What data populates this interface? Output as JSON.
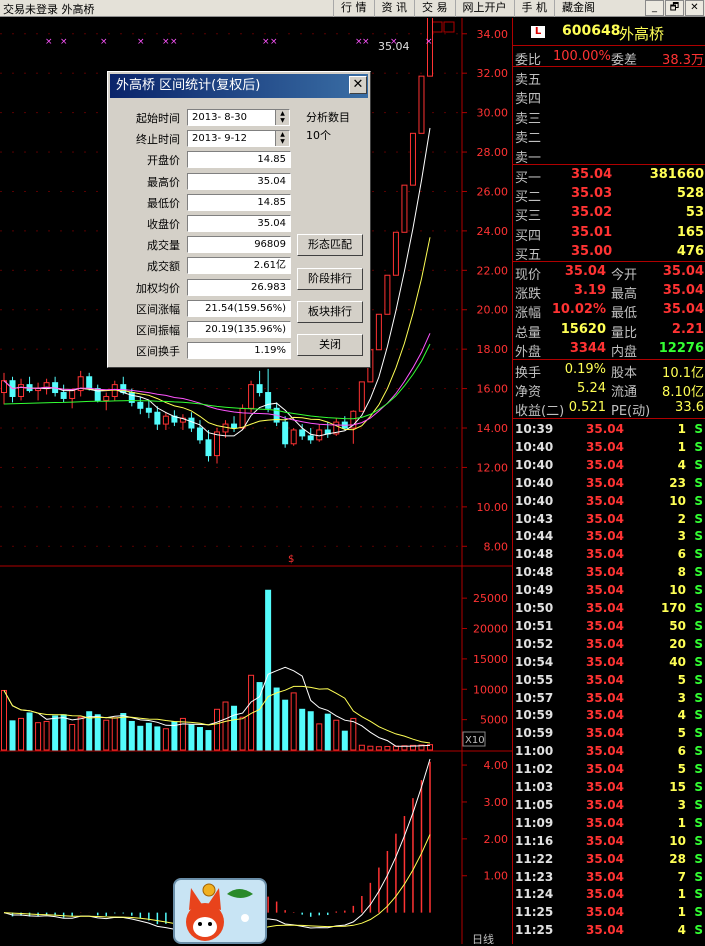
{
  "window": {
    "title": "交易未登录   外高桥",
    "menus": [
      "行 情",
      "资 讯",
      "交 易",
      "网上开户",
      "手 机",
      "藏金阁"
    ],
    "controls": [
      "_",
      "🗗",
      "✕"
    ]
  },
  "stock": {
    "code": "600648",
    "name": "外高桥",
    "badge": "L"
  },
  "chart_data": [
    {
      "type": "candlestick",
      "panel": "price",
      "ylim": [
        7,
        34.8
      ],
      "y_ticks": [
        "34.00",
        "32.00",
        "30.00",
        "28.00",
        "26.00",
        "24.00",
        "22.00",
        "20.00",
        "18.00",
        "16.00",
        "14.00",
        "12.00",
        "10.00",
        "8.00"
      ],
      "last_price_label": "35.04",
      "candles": [
        [
          15.8,
          16.8,
          15.2,
          16.4
        ],
        [
          16.4,
          16.6,
          15.3,
          15.6
        ],
        [
          15.6,
          16.5,
          15.4,
          16.2
        ],
        [
          16.2,
          16.6,
          15.8,
          15.9
        ],
        [
          15.9,
          16.3,
          15.4,
          16.0
        ],
        [
          16.0,
          16.5,
          15.7,
          16.3
        ],
        [
          16.3,
          16.6,
          15.6,
          15.8
        ],
        [
          15.8,
          16.2,
          15.3,
          15.5
        ],
        [
          15.5,
          16.0,
          15.0,
          15.9
        ],
        [
          15.9,
          16.9,
          15.6,
          16.6
        ],
        [
          16.6,
          16.8,
          15.9,
          16.0
        ],
        [
          16.0,
          16.2,
          15.3,
          15.4
        ],
        [
          15.4,
          15.8,
          14.9,
          15.6
        ],
        [
          15.6,
          16.4,
          15.4,
          16.2
        ],
        [
          16.2,
          16.6,
          15.7,
          15.8
        ],
        [
          15.8,
          16.0,
          15.1,
          15.3
        ],
        [
          15.3,
          15.6,
          14.7,
          15.0
        ],
        [
          15.0,
          15.4,
          14.5,
          14.8
        ],
        [
          14.8,
          15.1,
          13.9,
          14.2
        ],
        [
          14.2,
          14.8,
          13.9,
          14.6
        ],
        [
          14.6,
          14.9,
          14.1,
          14.3
        ],
        [
          14.3,
          14.7,
          13.9,
          14.5
        ],
        [
          14.5,
          14.8,
          13.8,
          14.0
        ],
        [
          14.0,
          14.4,
          13.2,
          13.4
        ],
        [
          13.4,
          13.9,
          12.3,
          12.6
        ],
        [
          12.6,
          14.0,
          12.2,
          13.8
        ],
        [
          13.8,
          14.4,
          13.5,
          14.2
        ],
        [
          14.2,
          14.6,
          13.8,
          14.0
        ],
        [
          14.0,
          15.2,
          13.9,
          15.0
        ],
        [
          15.0,
          16.4,
          14.8,
          16.2
        ],
        [
          16.2,
          16.9,
          15.6,
          15.8
        ],
        [
          15.8,
          17.0,
          14.8,
          15.0
        ],
        [
          15.0,
          15.3,
          14.1,
          14.3
        ],
        [
          14.3,
          14.6,
          13.0,
          13.2
        ],
        [
          13.2,
          14.0,
          13.1,
          13.9
        ],
        [
          13.9,
          14.2,
          13.4,
          13.6
        ],
        [
          13.6,
          14.0,
          13.2,
          13.4
        ],
        [
          13.4,
          14.2,
          13.3,
          13.9
        ],
        [
          13.9,
          14.3,
          13.5,
          13.7
        ],
        [
          13.7,
          14.5,
          13.6,
          14.3
        ],
        [
          14.3,
          14.6,
          13.9,
          14.0
        ],
        [
          14.0,
          14.9,
          13.2,
          14.85
        ],
        [
          14.85,
          16.34,
          14.85,
          16.34
        ],
        [
          16.34,
          17.97,
          16.34,
          17.97
        ],
        [
          17.97,
          19.77,
          17.97,
          19.77
        ],
        [
          19.77,
          21.75,
          19.77,
          21.75
        ],
        [
          21.75,
          23.93,
          21.75,
          23.93
        ],
        [
          23.93,
          26.32,
          23.93,
          26.32
        ],
        [
          26.32,
          28.95,
          26.32,
          28.95
        ],
        [
          28.95,
          31.85,
          28.95,
          31.85
        ],
        [
          31.85,
          35.04,
          31.85,
          35.04
        ]
      ],
      "volume": [
        9800,
        4800,
        5200,
        6100,
        4500,
        4700,
        5600,
        5800,
        4200,
        5400,
        6300,
        5800,
        4900,
        5300,
        6000,
        4700,
        3900,
        4400,
        3800,
        3500,
        4600,
        5200,
        4100,
        3700,
        3200,
        6700,
        7900,
        7200,
        5400,
        12300,
        11100,
        26300,
        10200,
        8200,
        9400,
        6700,
        6300,
        4300,
        5900,
        4900,
        3100,
        5200,
        780,
        620,
        540,
        580,
        620,
        700,
        760,
        820,
        880
      ],
      "vol_ylim": [
        0,
        27000
      ],
      "vol_ticks": [
        "25000",
        "20000",
        "15000",
        "10000",
        "5000"
      ],
      "vol_unit": "X10",
      "macd_ylim": [
        -0.85,
        4.3
      ],
      "macd_ticks": [
        "4.00",
        "3.00",
        "2.00",
        "1.00"
      ]
    }
  ],
  "dialog": {
    "title": "外高桥  区间统计(复权后)",
    "close": "✕",
    "fields": [
      {
        "label": "起始时间",
        "value": "2013- 8-30"
      },
      {
        "label": "终止时间",
        "value": "2013- 9-12"
      },
      {
        "label": "开盘价",
        "value": "14.85"
      },
      {
        "label": "最高价",
        "value": "35.04"
      },
      {
        "label": "最低价",
        "value": "14.85"
      },
      {
        "label": "收盘价",
        "value": "35.04"
      },
      {
        "label": "成交量",
        "value": "96809"
      },
      {
        "label": "成交额",
        "value": "2.61亿"
      },
      {
        "label": "加权均价",
        "value": "26.983"
      },
      {
        "label": "区间涨幅",
        "value": "21.54(159.56%)"
      },
      {
        "label": "区间振幅",
        "value": "20.19(135.96%)"
      },
      {
        "label": "区间换手",
        "value": "1.19%"
      }
    ],
    "analysis_label": "分析数目",
    "analysis_value": "10个",
    "buttons": [
      "形态匹配",
      "阶段排行",
      "板块排行",
      "关闭"
    ]
  },
  "quote": {
    "webi_label": "委比",
    "webi": "100.00%",
    "weicha_label": "委差",
    "weicha": "38.3万",
    "sells": [
      "卖五",
      "卖四",
      "卖三",
      "卖二",
      "卖一"
    ],
    "buys": [
      {
        "l": "买一",
        "p": "35.04",
        "v": "381660"
      },
      {
        "l": "买二",
        "p": "35.03",
        "v": "528"
      },
      {
        "l": "买三",
        "p": "35.02",
        "v": "53"
      },
      {
        "l": "买四",
        "p": "35.01",
        "v": "165"
      },
      {
        "l": "买五",
        "p": "35.00",
        "v": "476"
      }
    ],
    "stats1": [
      {
        "l1": "现价",
        "v1": "35.04",
        "c1": "#ff3333",
        "l2": "今开",
        "v2": "35.04",
        "c2": "#ff3333"
      },
      {
        "l1": "涨跌",
        "v1": "3.19",
        "c1": "#ff3333",
        "l2": "最高",
        "v2": "35.04",
        "c2": "#ff3333"
      },
      {
        "l1": "涨幅",
        "v1": "10.02%",
        "c1": "#ff3333",
        "l2": "最低",
        "v2": "35.04",
        "c2": "#ff3333"
      },
      {
        "l1": "总量",
        "v1": "15620",
        "c1": "#ffff55",
        "l2": "量比",
        "v2": "2.21",
        "c2": "#ff3333"
      },
      {
        "l1": "外盘",
        "v1": "3344",
        "c1": "#ff3333",
        "l2": "内盘",
        "v2": "12276",
        "c2": "#33ff33"
      }
    ],
    "stats2": [
      {
        "l1": "换手",
        "v1": "0.19%",
        "l2": "股本",
        "v2": "10.1亿"
      },
      {
        "l1": "净资",
        "v1": "5.24",
        "l2": "流通",
        "v2": "8.10亿"
      },
      {
        "l1": "收益(二)",
        "v1": "0.521",
        "l2": "PE(动)",
        "v2": "33.6"
      }
    ],
    "ticks": [
      [
        "10:39",
        "35.04",
        "1",
        "S"
      ],
      [
        "10:40",
        "35.04",
        "1",
        "S"
      ],
      [
        "10:40",
        "35.04",
        "4",
        "S"
      ],
      [
        "10:40",
        "35.04",
        "23",
        "S"
      ],
      [
        "10:40",
        "35.04",
        "10",
        "S"
      ],
      [
        "10:43",
        "35.04",
        "2",
        "S"
      ],
      [
        "10:44",
        "35.04",
        "3",
        "S"
      ],
      [
        "10:48",
        "35.04",
        "6",
        "S"
      ],
      [
        "10:48",
        "35.04",
        "8",
        "S"
      ],
      [
        "10:49",
        "35.04",
        "10",
        "S"
      ],
      [
        "10:50",
        "35.04",
        "170",
        "S"
      ],
      [
        "10:51",
        "35.04",
        "50",
        "S"
      ],
      [
        "10:52",
        "35.04",
        "20",
        "S"
      ],
      [
        "10:54",
        "35.04",
        "40",
        "S"
      ],
      [
        "10:55",
        "35.04",
        "5",
        "S"
      ],
      [
        "10:57",
        "35.04",
        "3",
        "S"
      ],
      [
        "10:59",
        "35.04",
        "4",
        "S"
      ],
      [
        "10:59",
        "35.04",
        "5",
        "S"
      ],
      [
        "11:00",
        "35.04",
        "6",
        "S"
      ],
      [
        "11:02",
        "35.04",
        "5",
        "S"
      ],
      [
        "11:03",
        "35.04",
        "15",
        "S"
      ],
      [
        "11:05",
        "35.04",
        "3",
        "S"
      ],
      [
        "11:09",
        "35.04",
        "1",
        "S"
      ],
      [
        "11:16",
        "35.04",
        "10",
        "S"
      ],
      [
        "11:22",
        "35.04",
        "28",
        "S"
      ],
      [
        "11:23",
        "35.04",
        "7",
        "S"
      ],
      [
        "11:24",
        "35.04",
        "1",
        "S"
      ],
      [
        "11:25",
        "35.04",
        "1",
        "S"
      ],
      [
        "11:25",
        "35.04",
        "4",
        "S"
      ]
    ]
  },
  "bottom_label": "日线"
}
